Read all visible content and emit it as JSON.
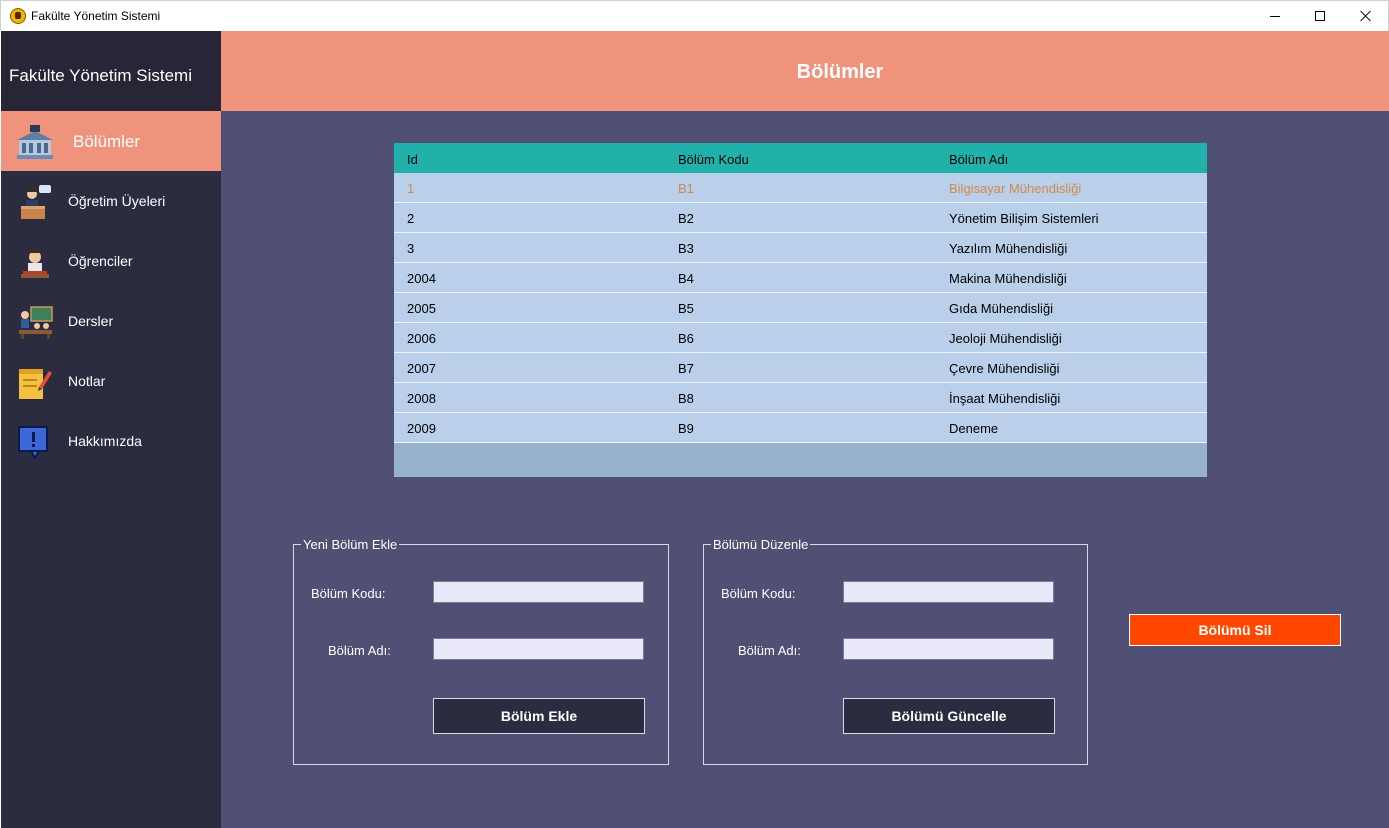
{
  "window": {
    "title": "Fakülte Yönetim Sistemi",
    "controls": [
      "minimize",
      "maximize",
      "close"
    ]
  },
  "sidebar": {
    "title": "Fakülte Yönetim Sistemi",
    "items": [
      {
        "label": "Bölümler",
        "icon": "building-icon",
        "active": true
      },
      {
        "label": "Öğretim Üyeleri",
        "icon": "teacher-icon",
        "active": false
      },
      {
        "label": "Öğrenciler",
        "icon": "student-icon",
        "active": false
      },
      {
        "label": "Dersler",
        "icon": "classroom-icon",
        "active": false
      },
      {
        "label": "Notlar",
        "icon": "notepad-icon",
        "active": false
      },
      {
        "label": "Hakkımızda",
        "icon": "info-icon",
        "active": false
      }
    ]
  },
  "header": {
    "title": "Bölümler"
  },
  "table": {
    "columns": [
      "Id",
      "Bölüm Kodu",
      "Bölüm Adı"
    ],
    "rows": [
      [
        "1",
        "B1",
        "Bilgisayar Mühendisliği"
      ],
      [
        "2",
        "B2",
        "Yönetim Bilişim Sistemleri"
      ],
      [
        "3",
        "B3",
        "Yazılım Mühendisliği"
      ],
      [
        "2004",
        "B4",
        "Makina Mühendisliği"
      ],
      [
        "2005",
        "B5",
        "Gıda Mühendisliği"
      ],
      [
        "2006",
        "B6",
        "Jeoloji Mühendisliği"
      ],
      [
        "2007",
        "B7",
        "Çevre Mühendisliği"
      ],
      [
        "2008",
        "B8",
        "İnşaat Mühendisliği"
      ],
      [
        "2009",
        "B9",
        "Deneme"
      ]
    ],
    "selected_row": 0
  },
  "add_group": {
    "legend": "Yeni Bölüm Ekle",
    "code_label": "Bölüm Kodu:",
    "name_label": "Bölüm Adı:",
    "code_value": "",
    "name_value": "",
    "button": "Bölüm Ekle"
  },
  "edit_group": {
    "legend": "Bölümü Düzenle",
    "code_label": "Bölüm Kodu:",
    "name_label": "Bölüm Adı:",
    "code_value": "",
    "name_value": "",
    "button": "Bölümü Güncelle"
  },
  "delete_button": "Bölümü Sil",
  "colors": {
    "sidebar": "#2c2c41",
    "accent": "#ef937c",
    "content": "#505074",
    "grid_header": "#20b2aa",
    "grid_row": "#b9cfea",
    "delete": "#ff4700"
  }
}
